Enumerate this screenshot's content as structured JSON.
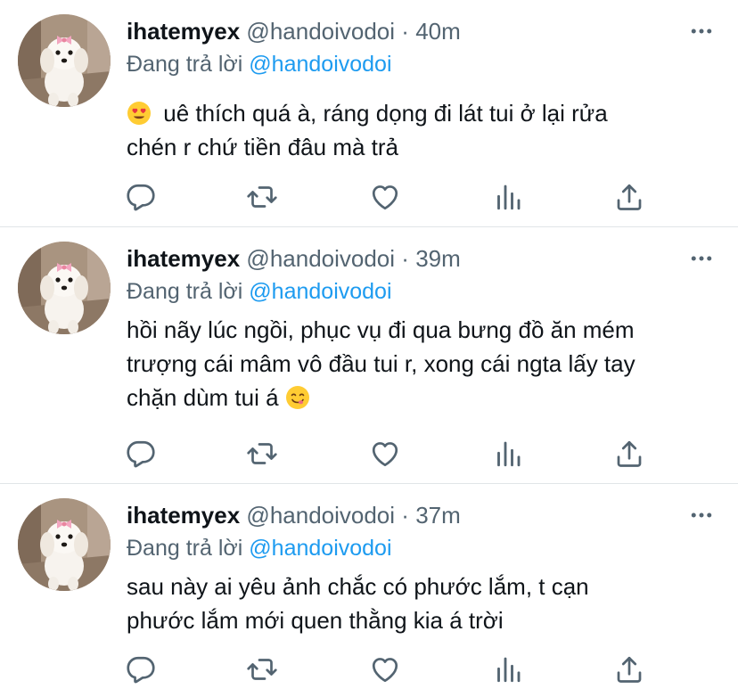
{
  "tweets": [
    {
      "name": "ihatemyex",
      "handle": "@handoivodoi",
      "dot": "·",
      "time": "40m",
      "replying_prefix": "Đang trả lời",
      "replying_to": "@handoivodoi",
      "lines": [
        "uê thích quá à, ráng dọng đi lát tui ở lại rửa",
        "chén r chứ tiền đâu mà trả"
      ],
      "emoji": "heart-eyes"
    },
    {
      "name": "ihatemyex",
      "handle": "@handoivodoi",
      "dot": "·",
      "time": "39m",
      "replying_prefix": "Đang trả lời",
      "replying_to": "@handoivodoi",
      "lines": [
        "hồi nãy lúc ngồi, phục vụ đi qua bưng đồ ăn mém",
        "trượng cái mâm vô đầu tui r, xong cái ngta lấy tay",
        "chặn dùm tui á"
      ],
      "emoji": "yum"
    },
    {
      "name": "ihatemyex",
      "handle": "@handoivodoi",
      "dot": "·",
      "time": "37m",
      "replying_prefix": "Đang trả lời",
      "replying_to": "@handoivodoi",
      "lines": [
        "sau này ai yêu ảnh chắc có phước lắm, t cạn",
        "phước lắm mới quen thằng kia á trời"
      ]
    }
  ],
  "colors": {
    "link": "#1d9bf0",
    "muted": "#536471",
    "text": "#0f1419"
  },
  "icons": [
    "reply-icon",
    "retweet-icon",
    "like-icon",
    "analytics-icon",
    "share-icon",
    "more-icon"
  ]
}
